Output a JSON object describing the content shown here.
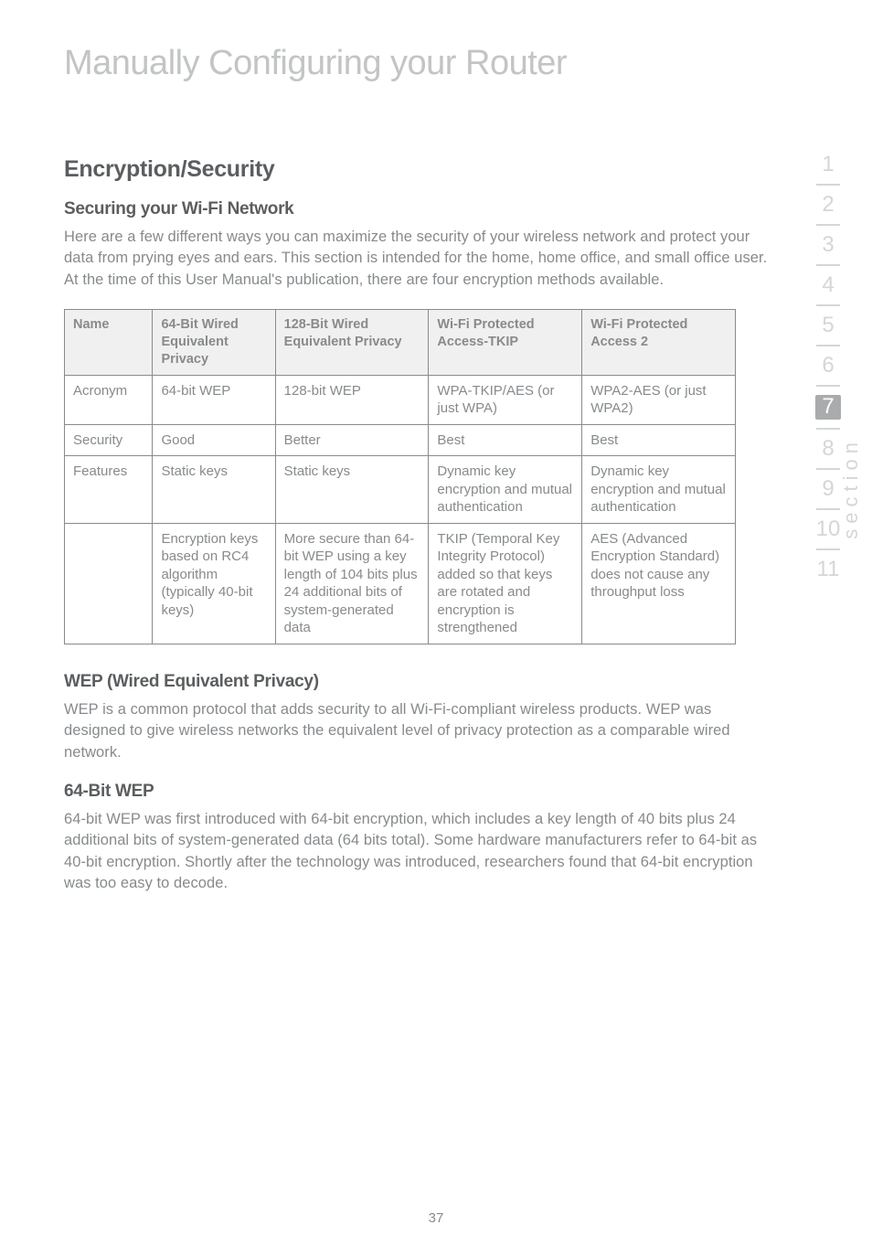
{
  "chapter_title": "Manually Configuring your Router",
  "section_heading": "Encryption/Security",
  "securing_heading": "Securing your Wi-Fi Network",
  "securing_body": "Here are a few different ways you can maximize the security of your wireless network and protect your data from prying eyes and ears. This section is intended for the home, home office, and small office user. At the time of this User Manual's publication, there are four encryption methods available.",
  "table": {
    "headers": {
      "name": "Name",
      "c64": "64-Bit Wired Equivalent Privacy",
      "c128": "128-Bit Wired Equivalent Privacy",
      "tkip": "Wi-Fi Protected Access-TKIP",
      "wpa2": "Wi-Fi Protected Access 2"
    },
    "rows": {
      "acronym": {
        "label": "Acronym",
        "c64": "64-bit WEP",
        "c128": "128-bit WEP",
        "tkip": "WPA-TKIP/AES (or just WPA)",
        "wpa2": "WPA2-AES (or just WPA2)"
      },
      "security": {
        "label": "Security",
        "c64": "Good",
        "c128": "Better",
        "tkip": "Best",
        "wpa2": "Best"
      },
      "features": {
        "label": "Features",
        "c64": "Static keys",
        "c128": "Static keys",
        "tkip": "Dynamic key encryption and mutual authentication",
        "wpa2": "Dynamic key encryption and mutual authentication"
      },
      "detail": {
        "label": "",
        "c64": "Encryption keys based on RC4 algorithm (typically 40-bit keys)",
        "c128": "More secure than 64-bit WEP using a key length of 104 bits plus 24 additional bits of system-generated data",
        "tkip": "TKIP (Temporal Key Integrity Protocol) added so that keys are rotated and encryption is strengthened",
        "wpa2": "AES (Advanced Encryption Standard) does not cause any throughput loss"
      }
    }
  },
  "wep_heading": "WEP (Wired Equivalent Privacy)",
  "wep_body": "WEP is a common protocol that adds security to all Wi-Fi-compliant wireless products. WEP was designed to give wireless networks the equivalent level of privacy protection as a comparable wired network.",
  "bit64_heading": "64-Bit WEP",
  "bit64_body": "64-bit WEP was first introduced with 64-bit encryption, which includes a key length of 40 bits plus 24 additional bits of system-generated data (64 bits total). Some hardware manufacturers refer to 64-bit as 40-bit encryption. Shortly after the technology was introduced, researchers found that 64-bit encryption was too easy to decode.",
  "sidebar": {
    "tabs": [
      "1",
      "2",
      "3",
      "4",
      "5",
      "6",
      "7",
      "8",
      "9",
      "10",
      "11"
    ],
    "active_index": 6,
    "label": "section"
  },
  "page_number": "37"
}
